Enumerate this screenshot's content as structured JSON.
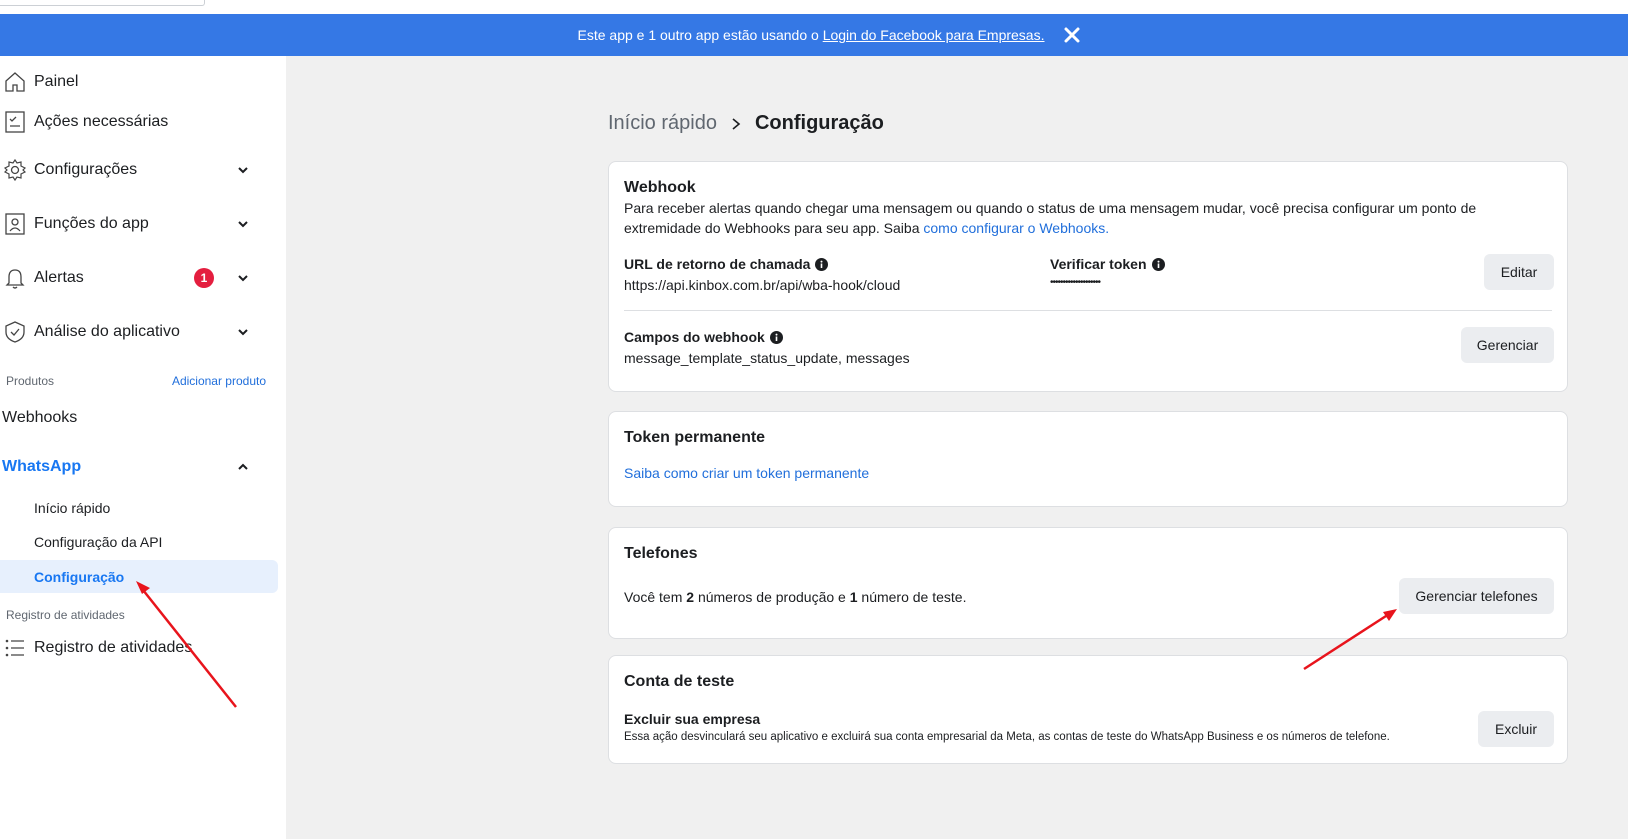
{
  "banner": {
    "text": "Este app e 1 outro app estão usando o ",
    "link": "Login do Facebook para Empresas.",
    "close_icon": "close-icon"
  },
  "sidebar": {
    "items": [
      {
        "label": "Painel",
        "icon": "home-icon"
      },
      {
        "label": "Ações necessárias",
        "icon": "checklist-icon"
      },
      {
        "label": "Configurações",
        "icon": "gear-icon"
      },
      {
        "label": "Funções do app",
        "icon": "user-badge-icon"
      },
      {
        "label": "Alertas",
        "icon": "bell-icon",
        "badge": "1"
      },
      {
        "label": "Análise do aplicativo",
        "icon": "shield-check-icon"
      }
    ],
    "products_label": "Produtos",
    "add_product": "Adicionar produto",
    "webhooks": "Webhooks",
    "whatsapp": "WhatsApp",
    "whatsapp_sub": [
      "Início rápido",
      "Configuração da API",
      "Configuração"
    ],
    "activity_label": "Registro de atividades",
    "activity_item": "Registro de atividades"
  },
  "breadcrumb": {
    "parent": "Início rápido",
    "current": "Configuração"
  },
  "webhook": {
    "title": "Webhook",
    "desc_1": "Para receber alertas quando chegar uma mensagem ou quando o status de uma mensagem mudar, você precisa configurar um ponto de",
    "desc_2": "extremidade do Webhooks para seu app. Saiba ",
    "desc_link": "como configurar o Webhooks.",
    "callback_label": "URL de retorno de chamada",
    "callback_value": "https://api.kinbox.com.br/api/wba-hook/cloud",
    "verify_label": "Verificar token",
    "verify_value": "••••••••••••••••••••",
    "edit_button": "Editar",
    "fields_label": "Campos do webhook",
    "fields_value": "message_template_status_update, messages",
    "manage_button": "Gerenciar"
  },
  "token": {
    "title": "Token permanente",
    "link": "Saiba como criar um token permanente"
  },
  "phones": {
    "title": "Telefones",
    "text_1": "Você tem ",
    "prod_count": "2",
    "text_2": " números de produção e ",
    "test_count": "1",
    "text_3": " número de teste.",
    "manage_button": "Gerenciar telefones"
  },
  "test_account": {
    "title": "Conta de teste",
    "subtitle": "Excluir sua empresa",
    "desc": "Essa ação desvinculará seu aplicativo e excluirá sua conta empresarial da Meta, as contas de teste do WhatsApp Business e os números de telefone.",
    "delete_button": "Excluir"
  },
  "colors": {
    "banner": "#3578e5",
    "accent": "#1877f2",
    "link": "#216fdb",
    "badge": "#e41e3f",
    "annotation_arrow": "#e8141c"
  }
}
